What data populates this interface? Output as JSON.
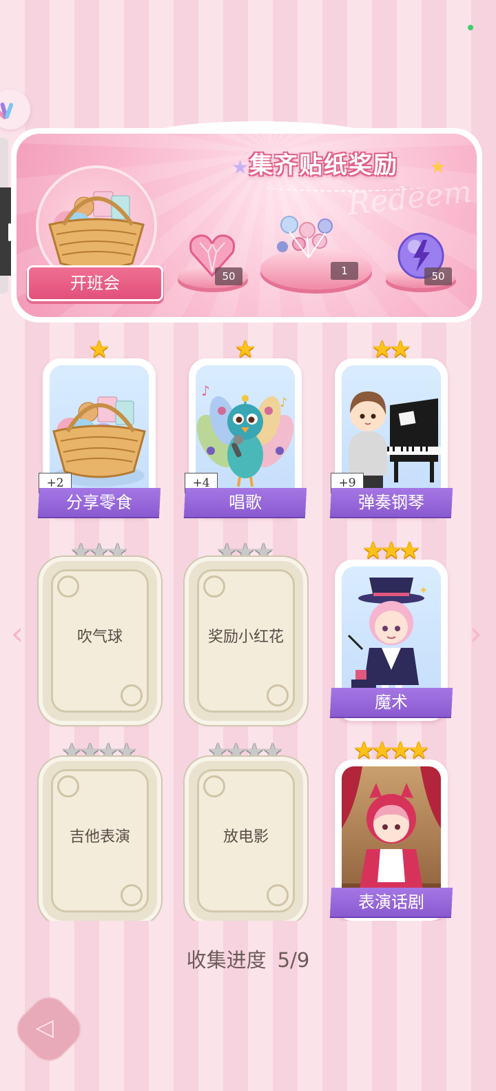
{
  "banner": {
    "title": "集齐贴纸奖励",
    "watermark": "Redeem",
    "event_label": "开班会",
    "rewards": [
      {
        "icon": "pink-heart-gem-icon",
        "count": "50"
      },
      {
        "icon": "candy-bouquet-icon",
        "count": "1"
      },
      {
        "icon": "purple-energy-orb-icon",
        "count": "50"
      }
    ]
  },
  "cards": [
    {
      "label": "分享零食",
      "stars": 1,
      "bonus": "+2",
      "unlocked": true,
      "art": "snack-basket-icon"
    },
    {
      "label": "唱歌",
      "stars": 1,
      "bonus": "+4",
      "unlocked": true,
      "art": "singing-peacock-icon"
    },
    {
      "label": "弹奏钢琴",
      "stars": 2,
      "bonus": "+9",
      "unlocked": true,
      "art": "boy-piano-icon"
    },
    {
      "label": "吹气球",
      "stars": 3,
      "unlocked": false
    },
    {
      "label": "奖励小红花",
      "stars": 3,
      "unlocked": false
    },
    {
      "label": "魔术",
      "stars": 3,
      "unlocked": true,
      "art": "magician-girl-icon"
    },
    {
      "label": "吉他表演",
      "stars": 4,
      "unlocked": false
    },
    {
      "label": "放电影",
      "stars": 4,
      "unlocked": false
    },
    {
      "label": "表演话剧",
      "stars": 4,
      "unlocked": true,
      "art": "red-hood-cat-girl-icon"
    }
  ],
  "progress": {
    "label": "收集进度",
    "value": "5/9",
    "collected": 5,
    "total": 9
  },
  "nav": {
    "prev_icon": "chevron-left-icon",
    "next_icon": "chevron-right-icon",
    "back_icon": "back-arrow-icon"
  },
  "colors": {
    "accent_pink": "#e3507b",
    "label_purple": "#8a5ad0",
    "star_gold": "#ffc21a",
    "locked_beige": "#f4ecdb"
  }
}
